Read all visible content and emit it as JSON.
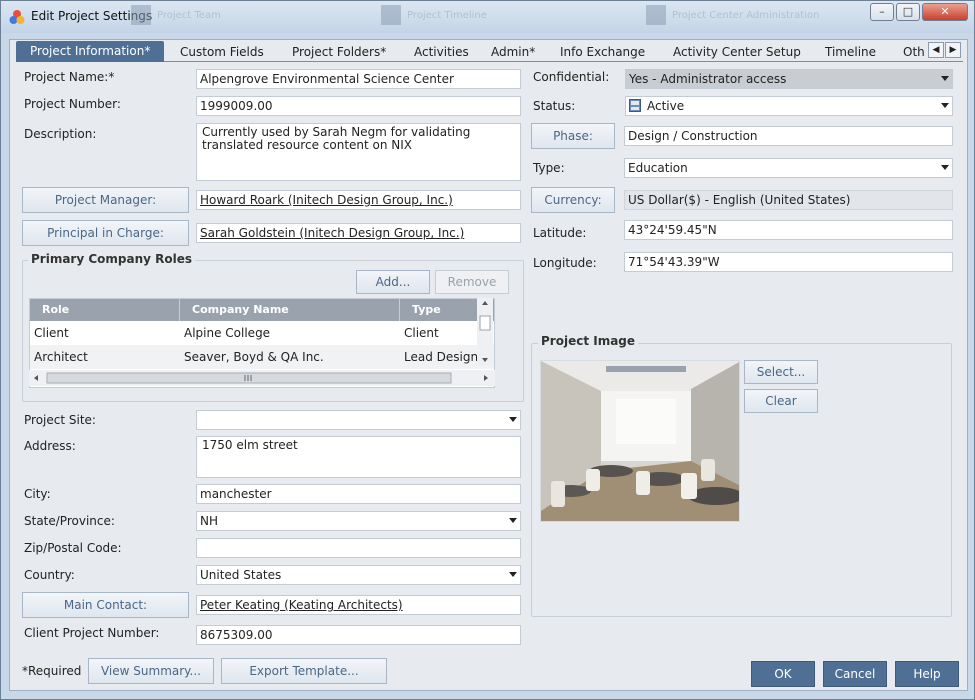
{
  "window": {
    "title": "Edit Project Settings",
    "ghost_items": [
      "Project Team",
      "Project Timeline",
      "Project Center Administration"
    ]
  },
  "tabs": [
    "Project Information*",
    "Custom Fields",
    "Project Folders*",
    "Activities",
    "Admin*",
    "Info Exchange",
    "Activity Center Setup",
    "Timeline",
    "Oth"
  ],
  "left": {
    "project_name_label": "Project Name:*",
    "project_name": "Alpengrove Environmental Science Center",
    "project_number_label": "Project Number:",
    "project_number": "1999009.00",
    "description_label": "Description:",
    "description": "Currently used by Sarah Negm for validating translated resource content on NIX",
    "project_manager_btn": "Project Manager:",
    "project_manager": "Howard Roark (Initech Design Group, Inc.)",
    "principal_btn": "Principal in Charge:",
    "principal": "Sarah Goldstein (Initech Design Group, Inc.)",
    "roles_title": "Primary Company Roles",
    "add_btn": "Add...",
    "remove_btn": "Remove",
    "roles_headers": [
      "Role",
      "Company Name",
      "Type"
    ],
    "roles_rows": [
      [
        "Client",
        "Alpine College",
        "Client"
      ],
      [
        "Architect",
        "Seaver, Boyd & QA Inc.",
        "Lead Designer"
      ]
    ],
    "project_site_label": "Project Site:",
    "project_site": "",
    "address_label": "Address:",
    "address": "1750 elm street",
    "city_label": "City:",
    "city": "manchester",
    "state_label": "State/Province:",
    "state": "NH",
    "zip_label": "Zip/Postal Code:",
    "zip": "",
    "country_label": "Country:",
    "country": "United States",
    "main_contact_btn": "Main Contact:",
    "main_contact": "Peter Keating (Keating Architects)",
    "client_project_number_label": "Client Project Number:",
    "client_project_number": "8675309.00"
  },
  "right": {
    "confidential_label": "Confidential:",
    "confidential": "Yes - Administrator access",
    "status_label": "Status:",
    "status": "Active",
    "phase_btn": "Phase:",
    "phase": "Design / Construction",
    "type_label": "Type:",
    "type": "Education",
    "currency_btn": "Currency:",
    "currency": "US Dollar($) - English (United States)",
    "latitude_label": "Latitude:",
    "latitude": "43°24'59.45\"N",
    "longitude_label": "Longitude:",
    "longitude": "71°54'43.39\"W",
    "image_title": "Project Image",
    "select_btn": "Select...",
    "clear_btn": "Clear"
  },
  "footer": {
    "required_note": "*Required",
    "view_summary": "View Summary...",
    "export_template": "Export Template...",
    "ok": "OK",
    "cancel": "Cancel",
    "help": "Help"
  }
}
